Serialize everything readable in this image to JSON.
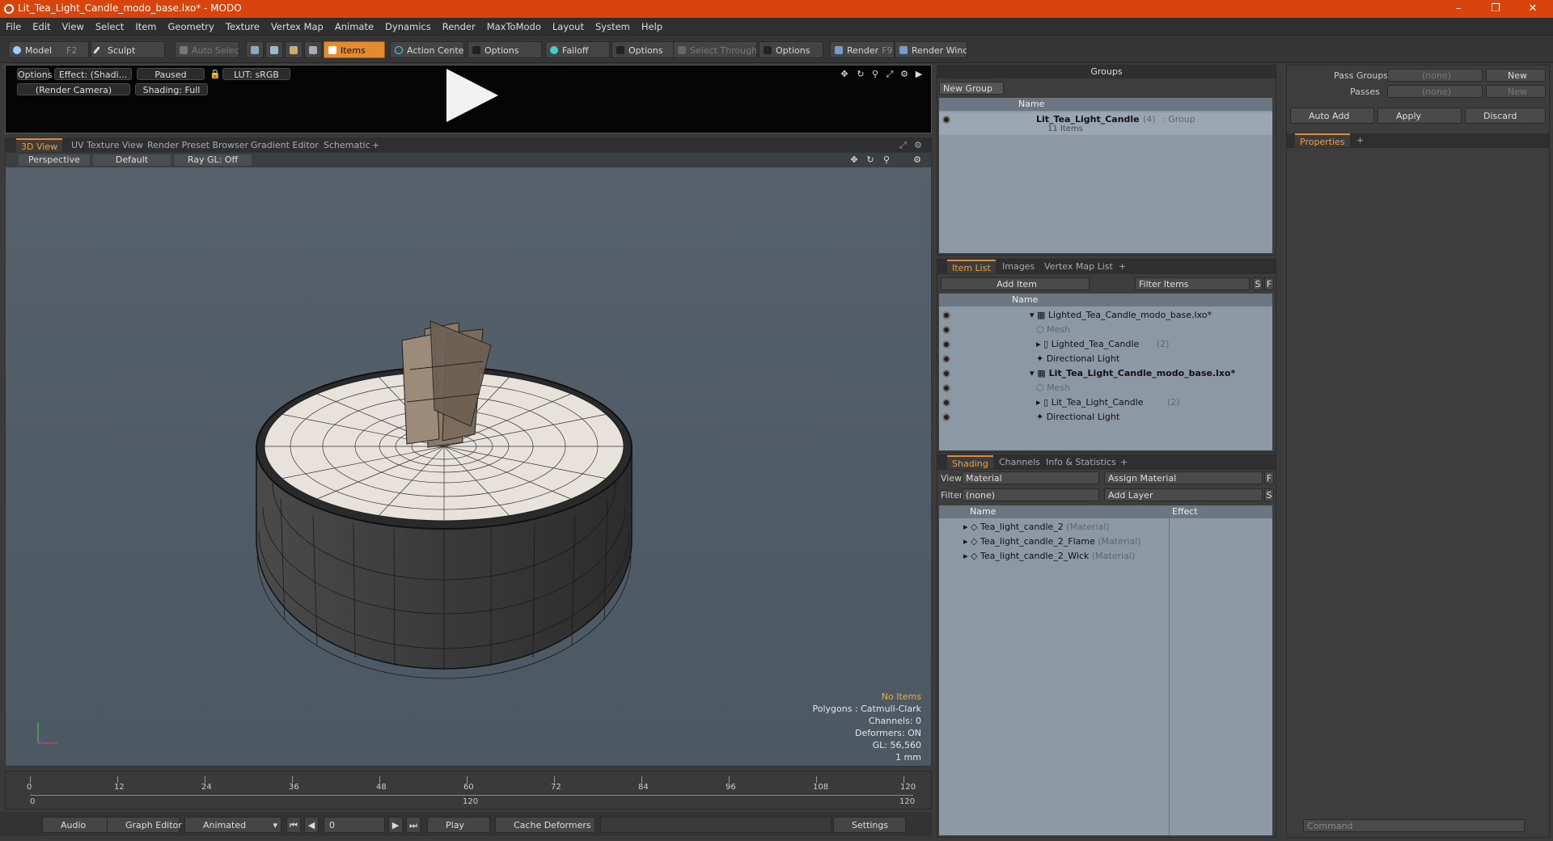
{
  "window": {
    "title": "Lit_Tea_Light_Candle_modo_base.lxo* - MODO"
  },
  "menu": [
    "File",
    "Edit",
    "View",
    "Select",
    "Item",
    "Geometry",
    "Texture",
    "Vertex Map",
    "Animate",
    "Dynamics",
    "Render",
    "MaxToModo",
    "Layout",
    "System",
    "Help"
  ],
  "toolbar": {
    "model": "Model",
    "model_key": "F2",
    "sculpt": "Sculpt",
    "auto_select": "Auto Select",
    "items": "Items",
    "action_center": "Action Center",
    "options1": "Options",
    "falloff": "Falloff",
    "options2": "Options",
    "select_through": "Select Through",
    "options3": "Options",
    "render": "Render",
    "render_key": "F9",
    "render_window": "Render Window"
  },
  "preview": {
    "options": "Options",
    "effect": "Effect: (Shadi...",
    "paused": "Paused",
    "lut": "LUT: sRGB",
    "camera": "(Render Camera)",
    "shading": "Shading: Full"
  },
  "viewport_tabs": [
    "3D View",
    "UV Texture View",
    "Render Preset Browser",
    "Gradient Editor",
    "Schematic",
    "+"
  ],
  "viewport": {
    "perspective": "Perspective",
    "default": "Default",
    "raygl": "Ray GL: Off",
    "stats": {
      "no_items": "No Items",
      "polygons": "Polygons : Catmull-Clark",
      "channels": "Channels: 0",
      "deformers": "Deformers: ON",
      "gl": "GL: 56,560",
      "unit": "1 mm"
    }
  },
  "timeline": {
    "ticks": [
      "0",
      "12",
      "24",
      "36",
      "48",
      "60",
      "72",
      "84",
      "96",
      "108",
      "120"
    ],
    "start": "0",
    "mid": "120",
    "end": "120"
  },
  "bottombar": {
    "audio": "Audio",
    "graph_editor": "Graph Editor",
    "animated": "Animated",
    "frame": "0",
    "play": "Play",
    "cache": "Cache Deformers",
    "settings": "Settings"
  },
  "groups": {
    "title": "Groups",
    "new_group": "New Group",
    "col_name": "Name",
    "group_name": "Lit_Tea_Light_Candle",
    "group_count": "(4)",
    "group_type": ": Group",
    "group_items": "11 Items"
  },
  "itemlist": {
    "tabs": [
      "Item List",
      "Images",
      "Vertex Map List",
      "+"
    ],
    "add_item": "Add Item",
    "filter": "Filter Items",
    "s": "S",
    "f": "F",
    "col_name": "Name",
    "rows": [
      {
        "label": "Lighted_Tea_Candle_modo_base.lxo*",
        "indent": 0,
        "type": "scene"
      },
      {
        "label": "Mesh",
        "indent": 1,
        "type": "mesh"
      },
      {
        "label": "Lighted_Tea_Candle",
        "count": "(2)",
        "indent": 1,
        "type": "group"
      },
      {
        "label": "Directional Light",
        "indent": 1,
        "type": "light"
      },
      {
        "label": "Lit_Tea_Light_Candle_modo_base.lxo*",
        "indent": 0,
        "type": "scene"
      },
      {
        "label": "Mesh",
        "indent": 1,
        "type": "mesh"
      },
      {
        "label": "Lit_Tea_Light_Candle",
        "count": "(2)",
        "indent": 1,
        "type": "group"
      },
      {
        "label": "Directional Light",
        "indent": 1,
        "type": "light"
      }
    ]
  },
  "shading": {
    "tabs": [
      "Shading",
      "Channels",
      "Info & Statistics",
      "+"
    ],
    "view_label": "View",
    "view_value": "Material",
    "assign_material": "Assign Material",
    "f": "F",
    "filter_label": "Filter",
    "filter_value": "(none)",
    "add_layer": "Add Layer",
    "s": "S",
    "col_name": "Name",
    "col_effect": "Effect",
    "rows": [
      {
        "label": "Tea_light_candle_2",
        "type": "(Material)"
      },
      {
        "label": "Tea_light_candle_2_Flame",
        "type": "(Material)"
      },
      {
        "label": "Tea_light_candle_2_Wick",
        "type": "(Material)"
      }
    ]
  },
  "passes": {
    "pass_groups": "Pass Groups",
    "passes": "Passes",
    "none1": "(none)",
    "none2": "(none)",
    "new1": "New",
    "new2": "New",
    "auto_add": "Auto Add",
    "apply": "Apply",
    "discard": "Discard"
  },
  "properties": {
    "tab": "Properties",
    "plus": "+"
  },
  "command": {
    "placeholder": "Command"
  }
}
